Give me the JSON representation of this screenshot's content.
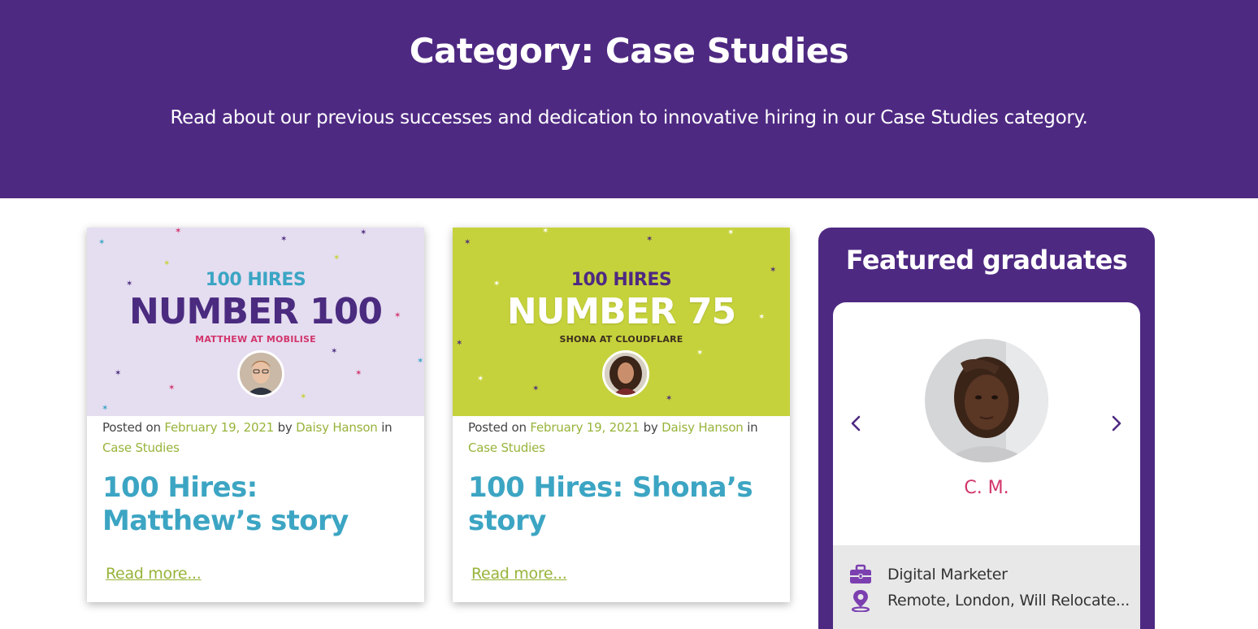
{
  "hero": {
    "title": "Category: Case Studies",
    "description": "Read about our previous successes and dedication to innovative hiring in our Case Studies category."
  },
  "posts": [
    {
      "thumb": {
        "kicker": "100 HIRES",
        "headline": "NUMBER 100",
        "subline": "MATTHEW AT MOBILISE"
      },
      "posted_on_label": "Posted on",
      "date": "February 19, 2021",
      "by_label": "by",
      "author": "Daisy Hanson",
      "in_label": "in",
      "category": "Case Studies",
      "title": "100 Hires: Matthew’s story",
      "read_more": "Read more..."
    },
    {
      "thumb": {
        "kicker": "100 HIRES",
        "headline": "NUMBER 75",
        "subline": "SHONA AT CLOUDFLARE"
      },
      "posted_on_label": "Posted on",
      "date": "February 19, 2021",
      "by_label": "by",
      "author": "Daisy Hanson",
      "in_label": "in",
      "category": "Case Studies",
      "title": "100 Hires: Shona’s story",
      "read_more": "Read more..."
    }
  ],
  "featured": {
    "heading": "Featured graduates",
    "graduate": {
      "name": "C. M.",
      "role": "Digital Marketer",
      "location": "Remote, London, Will Relocate..."
    },
    "icons": {
      "prev": "chevron-left-icon",
      "next": "chevron-right-icon",
      "role": "briefcase-icon",
      "location": "map-pin-icon"
    }
  },
  "colors": {
    "brand_purple": "#4e2982",
    "link_green": "#97b43a",
    "title_blue": "#3ca5c3",
    "accent_pink": "#d2356b",
    "thumb_lilac": "#e5ddf0",
    "thumb_lime": "#c6d23b"
  }
}
